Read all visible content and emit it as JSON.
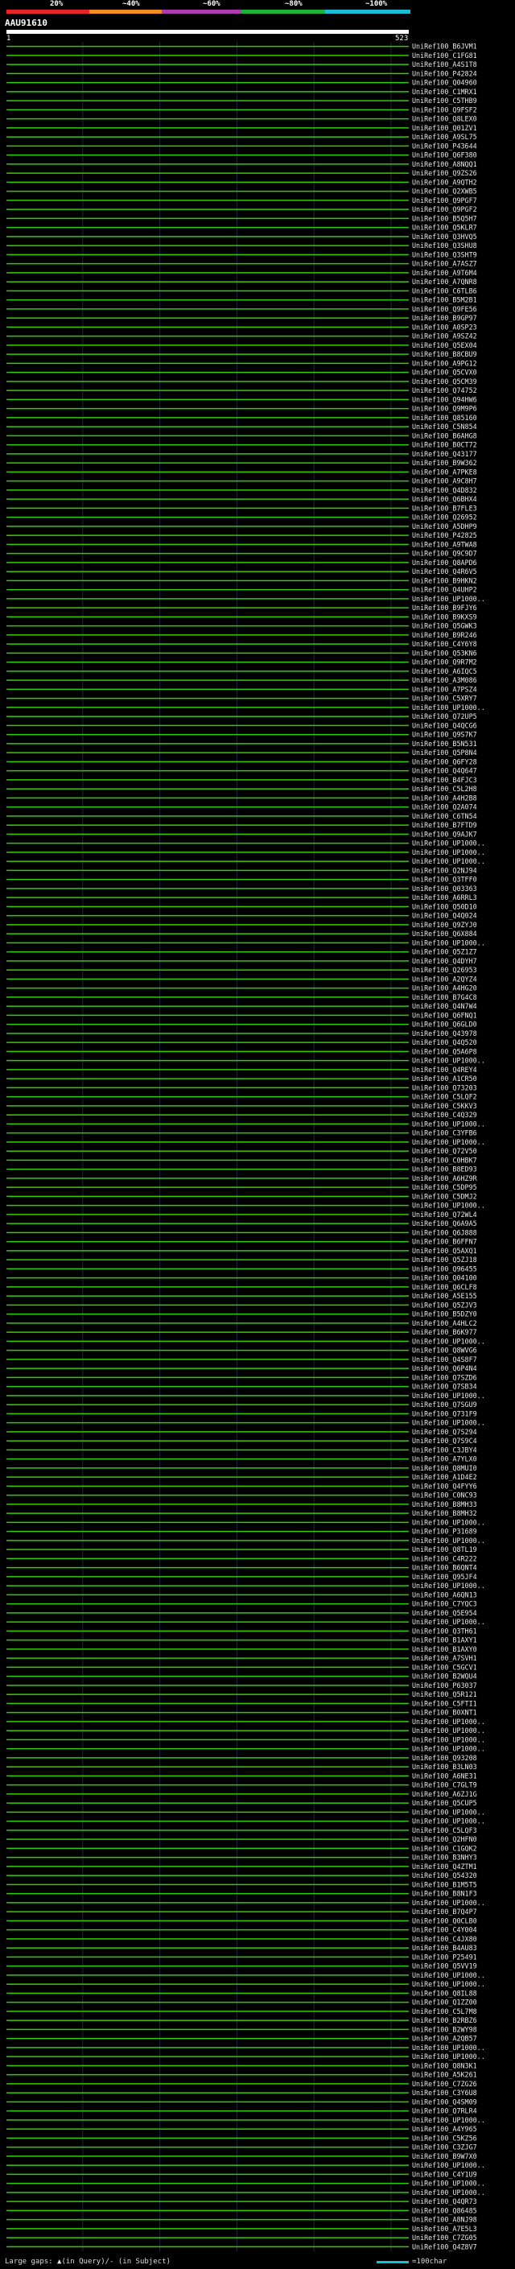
{
  "header": {
    "query_id": "AAU91610",
    "pct_labels": [
      "20%",
      "~40%",
      "~60%",
      "~80%",
      "~100%"
    ],
    "color_bands": [
      "#e8262a",
      "#f28c1e",
      "#b03ab0",
      "#1db33b",
      "#19bfd6"
    ],
    "q_start": "1",
    "q_end": "523"
  },
  "colors": {
    "hit": "#33cc00",
    "line": "#26a300",
    "gap": "#ffffff",
    "scale": "#19bfd6",
    "bg": "#000000"
  },
  "footer": {
    "legend": "Large gaps: ▲(in Query)/- (in Subject)",
    "scale": "=100char"
  },
  "chart_data": {
    "type": "alignment",
    "query_length": 523,
    "hits": [
      "UniRef100_B6JVM1",
      "UniRef100_C1FG81",
      "UniRef100_A4S1T8",
      "UniRef100_P42824",
      "UniRef100_Q04960",
      "UniRef100_C1MRX1",
      "UniRef100_C5THB9",
      "UniRef100_Q9FSF2",
      "UniRef100_Q8LEX0",
      "UniRef100_Q01ZV1",
      "UniRef100_A9SL75",
      "UniRef100_P43644",
      "UniRef100_Q6F380",
      "UniRef100_A8NQQ1",
      "UniRef100_Q9ZS26",
      "UniRef100_A9QTH2",
      "UniRef100_Q2XWB5",
      "UniRef100_Q9PGF7",
      "UniRef100_Q9PGF2",
      "UniRef100_B5Q5H7",
      "UniRef100_Q5KLR7",
      "UniRef100_Q3HVQ5",
      "UniRef100_Q3SHU8",
      "UniRef100_Q3SHT9",
      "UniRef100_A7ASZ7",
      "UniRef100_A9T6M4",
      "UniRef100_A7QNR8",
      "UniRef100_C6TLB6",
      "UniRef100_B5M2B1",
      "UniRef100_Q9FE56",
      "UniRef100_B9GP97",
      "UniRef100_A0SP23",
      "UniRef100_A9SZ42",
      "UniRef100_Q5EX04",
      "UniRef100_B8CBU9",
      "UniRef100_A9PG12",
      "UniRef100_Q5CVX0",
      "UniRef100_Q5CM39",
      "UniRef100_Q74752",
      "UniRef100_Q94HW6",
      "UniRef100_Q9M9P6",
      "UniRef100_Q85160",
      "UniRef100_C5N854",
      "UniRef100_B6AHG8",
      "UniRef100_B0CT72",
      "UniRef100_Q43177",
      "UniRef100_B9W362",
      "UniRef100_A7PKE8",
      "UniRef100_A9C8H7",
      "UniRef100_Q4D832",
      "UniRef100_Q6BHX4",
      "UniRef100_B7FLE3",
      "UniRef100_Q26952",
      "UniRef100_A5DHP9",
      "UniRef100_P42825",
      "UniRef100_A9TWA8",
      "UniRef100_Q9C9D7",
      "UniRef100_Q8APD6",
      "UniRef100_Q4R6V5",
      "UniRef100_B9HKN2",
      "UniRef100_Q4UHP2",
      "UniRef100_UP1000..",
      "UniRef100_B9FJY6",
      "UniRef100_B9KXS9",
      "UniRef100_Q5GWK3",
      "UniRef100_B9R246",
      "UniRef100_C4Y6Y8",
      "UniRef100_Q53KN6",
      "UniRef100_Q9R7M2",
      "UniRef100_A6IQC5",
      "UniRef100_A3M086",
      "UniRef100_A7PSZ4",
      "UniRef100_C5XRY7",
      "UniRef100_UP1000..",
      "UniRef100_Q72UP5",
      "UniRef100_Q4QCG6",
      "UniRef100_Q9S7K7",
      "UniRef100_B5N531",
      "UniRef100_Q5P8N4",
      "UniRef100_Q6FY28",
      "UniRef100_Q4Q647",
      "UniRef100_B4FJC3",
      "UniRef100_C5L2H8",
      "UniRef100_A4H2B8",
      "UniRef100_Q2A074",
      "UniRef100_C6TN54",
      "UniRef100_B7FTD9",
      "UniRef100_Q9AJK7",
      "UniRef100_UP1000..",
      "UniRef100_UP1000..",
      "UniRef100_UP1000..",
      "UniRef100_Q2NJ94",
      "UniRef100_Q3TFF0",
      "UniRef100_Q03363",
      "UniRef100_A6RRL3",
      "UniRef100_Q50D10",
      "UniRef100_Q4Q024",
      "UniRef100_Q9ZYJ0",
      "UniRef100_Q6X884",
      "UniRef100_UP1000..",
      "UniRef100_Q5Z1Z7",
      "UniRef100_Q4DYH7",
      "UniRef100_Q26953",
      "UniRef100_A2QYZ4",
      "UniRef100_A4HG20",
      "UniRef100_B7G4C8",
      "UniRef100_Q4N7W4",
      "UniRef100_Q6FNQ1",
      "UniRef100_Q6GLD0",
      "UniRef100_Q43978",
      "UniRef100_Q4Q520",
      "UniRef100_Q5A6P8",
      "UniRef100_UP1000..",
      "UniRef100_Q4REY4",
      "UniRef100_A1CR50",
      "UniRef100_Q73203",
      "UniRef100_C5LQF2",
      "UniRef100_C5KKV3",
      "UniRef100_C4Q329",
      "UniRef100_UP1000..",
      "UniRef100_C3YFB6",
      "UniRef100_UP1000..",
      "UniRef100_Q72V50",
      "UniRef100_C0HBK7",
      "UniRef100_B8ED93",
      "UniRef100_A6HZ9R",
      "UniRef100_C5DP95",
      "UniRef100_C5DMJ2",
      "UniRef100_UP1000..",
      "UniRef100_Q72WL4",
      "UniRef100_Q6A9A5",
      "UniRef100_Q6J888",
      "UniRef100_B6FFN7",
      "UniRef100_Q5AXQ1",
      "UniRef100_Q5ZJ18",
      "UniRef100_Q96455",
      "UniRef100_Q04100",
      "UniRef100_Q6CLF8",
      "UniRef100_A5E155",
      "UniRef100_Q5ZJV3",
      "UniRef100_B5DZY0",
      "UniRef100_A4HLC2",
      "UniRef100_B6K977",
      "UniRef100_UP1000..",
      "UniRef100_Q8WVG6",
      "UniRef100_Q4S8F7",
      "UniRef100_Q6P4N4",
      "UniRef100_Q7SZD6",
      "UniRef100_Q7SB34",
      "UniRef100_UP1000..",
      "UniRef100_Q7SGU9",
      "UniRef100_Q731F9",
      "UniRef100_UP1000..",
      "UniRef100_Q7S294",
      "UniRef100_Q7S9C4",
      "UniRef100_C3JBY4",
      "UniRef100_A7YLX0",
      "UniRef100_Q8MUI0",
      "UniRef100_A1D4E2",
      "UniRef100_Q4FYY6",
      "UniRef100_C0NC93",
      "UniRef100_B8MH33",
      "UniRef100_B8MH32",
      "UniRef100_UP1000..",
      "UniRef100_P31689",
      "UniRef100_UP1000..",
      "UniRef100_Q8TL19",
      "UniRef100_C4R222",
      "UniRef100_B6QNT4",
      "UniRef100_Q95JF4",
      "UniRef100_UP1000..",
      "UniRef100_A6QN13",
      "UniRef100_C7YQC3",
      "UniRef100_Q5E954",
      "UniRef100_UP1000..",
      "UniRef100_Q3TH61",
      "UniRef100_B1AXY1",
      "UniRef100_B1AXY0",
      "UniRef100_A7SVH1",
      "UniRef100_C5GCV1",
      "UniRef100_B2WQU4",
      "UniRef100_P63037",
      "UniRef100_Q5R121",
      "UniRef100_C5FTI1",
      "UniRef100_B0XNT1",
      "UniRef100_UP1000..",
      "UniRef100_UP1000..",
      "UniRef100_UP1000..",
      "UniRef100_UP1000..",
      "UniRef100_Q93208",
      "UniRef100_B3LN03",
      "UniRef100_A6NE31",
      "UniRef100_C7GLT9",
      "UniRef100_A6ZJ1G",
      "UniRef100_Q5CUP5",
      "UniRef100_UP1000..",
      "UniRef100_UP1000..",
      "UniRef100_C5LQF3",
      "UniRef100_Q2HFN0",
      "UniRef100_C1GQK2",
      "UniRef100_B3NHY3",
      "UniRef100_Q4ZTM1",
      "UniRef100_Q54320",
      "UniRef100_B1M5T5",
      "UniRef100_B8N1F3",
      "UniRef100_UP1000..",
      "UniRef100_B7Q4P7",
      "UniRef100_Q0CLB0",
      "UniRef100_C4Y004",
      "UniRef100_C4JX80",
      "UniRef100_B4AU83",
      "UniRef100_P25491",
      "UniRef100_Q5VV19",
      "UniRef100_UP1000..",
      "UniRef100_UP1000..",
      "UniRef100_Q8IL88",
      "UniRef100_Q1ZZ00",
      "UniRef100_C5L7M8",
      "UniRef100_B2RBZ6",
      "UniRef100_B2WY98",
      "UniRef100_A2QB57",
      "UniRef100_UP1000..",
      "UniRef100_UP1000..",
      "UniRef100_Q8N3K1",
      "UniRef100_A5K261",
      "UniRef100_C7ZG26",
      "UniRef100_C3Y6U8",
      "UniRef100_Q4SM09",
      "UniRef100_Q7RLR4",
      "UniRef100_UP1000..",
      "UniRef100_A4Y965",
      "UniRef100_C5KZ56",
      "UniRef100_C3ZJG7",
      "UniRef100_B9W7X0",
      "UniRef100_UP1000..",
      "UniRef100_C4Y1U9",
      "UniRef100_UP1000..",
      "UniRef100_UP1000..",
      "UniRef100_Q4QR73",
      "UniRef100_Q86485",
      "UniRef100_A8NJ98",
      "UniRef100_A7E5L3",
      "UniRef100_C7ZG05",
      "UniRef100_Q4Z8V7"
    ]
  }
}
